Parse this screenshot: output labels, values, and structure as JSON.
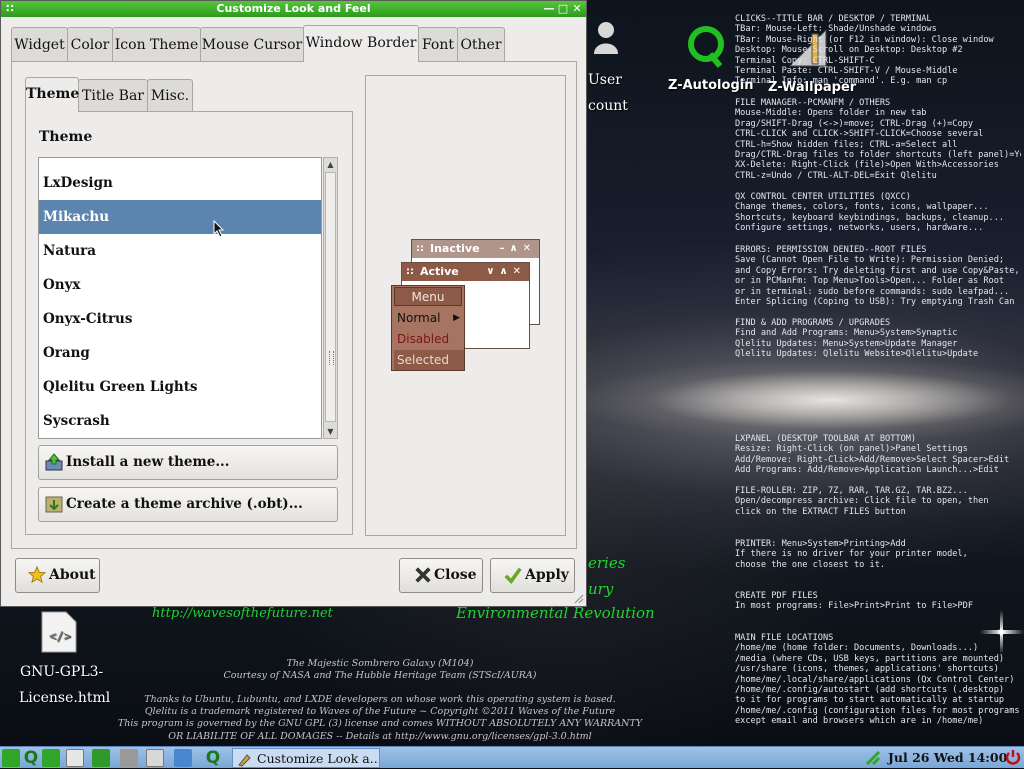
{
  "window": {
    "title": "Customize Look and Feel",
    "tabs": [
      "Widget",
      "Color",
      "Icon Theme",
      "Mouse Cursor",
      "Window Border",
      "Font",
      "Other"
    ],
    "active_tab": "Window Border",
    "subtabs": [
      "Theme",
      "Title Bar",
      "Misc."
    ],
    "active_subtab": "Theme",
    "theme_section_label": "Theme",
    "themes": [
      "LxDesign",
      "Mikachu",
      "Natura",
      "Onyx",
      "Onyx-Citrus",
      "Orang",
      "Qlelitu Green Lights",
      "Syscrash"
    ],
    "selected_theme": "Mikachu",
    "install_button": "Install a new theme...",
    "archive_button": "Create a theme archive (.obt)...",
    "about_button": "About",
    "close_button": "Close",
    "apply_button": "Apply"
  },
  "preview": {
    "inactive_title": "Inactive",
    "active_title": "Active",
    "menu_title": "Menu",
    "menu_items": [
      "Normal",
      "Disabled",
      "Selected"
    ],
    "colors": {
      "inactive_bar": "#b0968a",
      "active_bar": "#8c5a47",
      "menu_bg": "#a87462"
    }
  },
  "desktop": {
    "icons": {
      "user_account_line1": "User",
      "user_account_line2": "count",
      "autologin": "Z-Autologin",
      "wallpaper": "Z-Wallpaper",
      "license_line1": "GNU-GPL3-",
      "license_line2": "License.html"
    },
    "help_sections": [
      "CLICKS--TITLE BAR / DESKTOP / TERMINAL\nTBar: Mouse-Left: Shade/Unshade windows\nTBar: Mouse-Right (or F12 in window): Close window\nDesktop: Mouse-Scroll on Desktop: Desktop #2\nTerminal Copy: CTRL-SHIFT-C\nTerminal Paste: CTRL-SHIFT-V / Mouse-Middle\nTerminal Info: man 'command'. E.g. man cp",
      "FILE MANAGER--PCMANFM / OTHERS\nMouse-Middle: Opens folder in new tab\nDrag/SHIFT-Drag (<->)=move; CTRL-Drag (+)=Copy\nCTRL-CLICK and CLICK->SHIFT-CLICK=Choose several\nCTRL-h=Show hidden files; CTRL-a=Select all\nDrag/CTRL-Drag files to folder shortcuts (left panel)=Yes\nXX-Delete: Right-Click (file)>Open With>Accessories\nCTRL-z=Undo / CTRL-ALT-DEL=Exit Qlelitu",
      "QX CONTROL CENTER UTILITIES (QXCC)\nChange themes, colors, fonts, icons, wallpaper...\nShortcuts, keyboard keybindings, backups, cleanup...\nConfigure settings, networks, users, hardware...",
      "ERRORS: PERMISSION DENIED--ROOT FILES\nSave (Cannot Open File to Write): Permission Denied;\nand Copy Errors: Try deleting first and use Copy&Paste,\nor in PCManFm: Top Menu>Tools>Open... Folder as Root\nor in terminal: sudo before commands: sudo leafpad...\nEnter Splicing (Coping to USB): Try emptying Trash Can",
      "FIND & ADD PROGRAMS / UPGRADES\nFind and Add Programs: Menu>System>Synaptic\nQlelitu Updates: Menu>System>Update Manager\nQlelitu Updates: Qlelitu Website>Qlelitu>Update",
      "LXPANEL (DESKTOP TOOLBAR AT BOTTOM)\nResize: Right-Click (on panel)>Panel Settings\nAdd/Remove: Right-Click>Add/Remove>Select Spacer>Edit\nAdd Programs: Add/Remove>Application Launch...>Edit",
      "FILE-ROLLER: ZIP, 7Z, RAR, TAR.GZ, TAR.BZ2...\nOpen/decompress archive: Click file to open, then\nclick on the EXTRACT FILES button",
      "PRINTER: Menu>System>Printing>Add\nIf there is no driver for your printer model,\nchoose the one closest to it.",
      "CREATE PDF FILES\nIn most programs: File>Print>Print to File>PDF",
      "MAIN FILE LOCATIONS\n/home/me (home folder: Documents, Downloads...)\n/media (where CDs, USB keys, partitions are mounted)\n/usr/share (icons, themes, applications' shortcuts)\n/home/me/.local/share/applications (Qx Control Center)\n/home/me/.config/autostart (add shortcuts (.desktop)\nto it for programs to start automatically at startup\n/home/me/.config (configuration files for most programs\nexcept email and browsers which are in /home/me)"
    ],
    "script_lines": [
      "eries",
      "ury",
      "http://wavesofthefuture.net",
      "Environmental Revolution"
    ],
    "credits": [
      "The Majestic Sombrero Galaxy (M104)",
      "Courtesy of NASA and The Hubble Heritage Team (STScI/AURA)",
      "Thanks to Ubuntu, Lubuntu, and LXDE developers on whose work this operating system is based.",
      "Qlelitu is a trademark registered to Waves of the Future ~ Copyright ©2011  Waves of the Future",
      "This program is governed by the GNU GPL (3) license and comes WITHOUT ABSOLUTELY ANY WARRANTY",
      "OR LIABILITE OF ALL DOMAGES -- Details at http://www.gnu.org/licenses/gpl-3.0.html"
    ]
  },
  "taskbar": {
    "task_label": "Customize Look a...",
    "clock": "Jul 26  Wed  14:00",
    "colors": {
      "panel": "#8fb6e0",
      "accent_green": "#2fa52a"
    }
  }
}
